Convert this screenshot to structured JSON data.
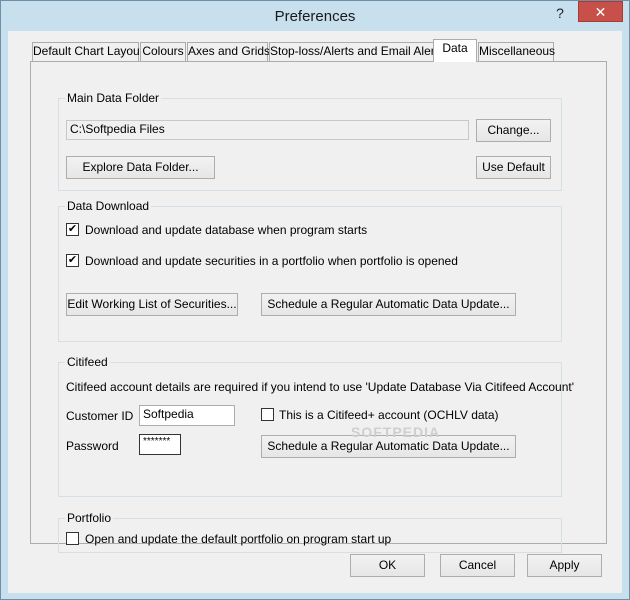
{
  "window": {
    "title": "Preferences",
    "help_glyph": "?",
    "close_glyph": "✕"
  },
  "tabs": [
    {
      "label": "Default Chart Layout"
    },
    {
      "label": "Colours"
    },
    {
      "label": "Axes and Grids"
    },
    {
      "label": "Stop-loss/Alerts and Email Alerts"
    },
    {
      "label": "Data"
    },
    {
      "label": "Miscellaneous"
    }
  ],
  "main_folder": {
    "legend": "Main Data Folder",
    "path": "C:\\Softpedia Files",
    "change_label": "Change...",
    "explore_label": "Explore Data Folder...",
    "default_label": "Use Default"
  },
  "data_download": {
    "legend": "Data Download",
    "opt1_label": "Download and update database when program starts",
    "opt1_checked": "✔",
    "opt2_label": "Download and update securities in a portfolio when portfolio is opened",
    "opt2_checked": "✔",
    "edit_label": "Edit Working List of Securities...",
    "schedule_label": "Schedule a Regular Automatic Data Update..."
  },
  "citifeed": {
    "legend": "Citifeed",
    "info": "Citifeed account details are required if you intend to use 'Update Database Via Citifeed Account'",
    "customer_id_label": "Customer ID",
    "customer_id_value": "Softpedia",
    "password_label": "Password",
    "password_value": "*******",
    "plus_label": "This is a Citifeed+ account (OCHLV data)",
    "schedule_label": "Schedule a Regular Automatic Data Update..."
  },
  "portfolio": {
    "legend": "Portfolio",
    "open_label": "Open and update the default portfolio on program start up"
  },
  "footer": {
    "ok_label": "OK",
    "cancel_label": "Cancel",
    "apply_label": "Apply"
  },
  "watermark": "SOFTPEDIA"
}
